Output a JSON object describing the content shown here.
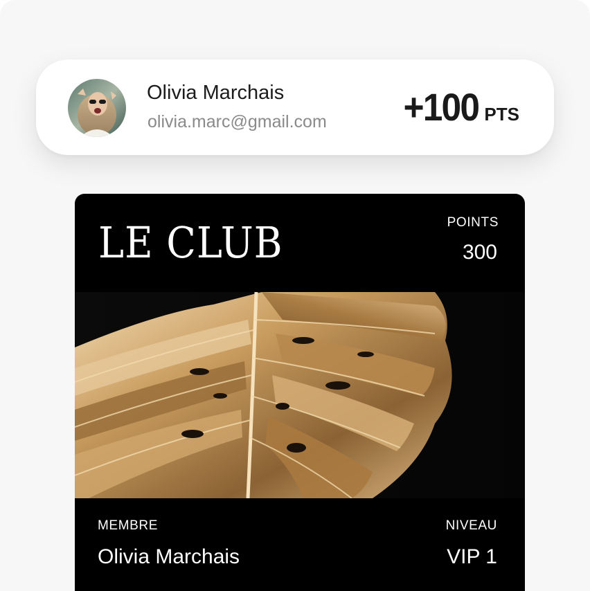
{
  "user": {
    "name": "Olivia Marchais",
    "email": "olivia.marc@gmail.com",
    "points_earned": "+100",
    "points_unit": "PTS"
  },
  "club_card": {
    "title": "LE CLUB",
    "points_label": "POINTS",
    "points_value": "300",
    "member_label": "MEMBRE",
    "member_value": "Olivia Marchais",
    "level_label": "NIVEAU",
    "level_value": "VIP 1"
  },
  "colors": {
    "background": "#f7f7f7",
    "card": "#000000",
    "gold": "#c9a46a",
    "text_dark": "#1c1c1c",
    "text_muted": "#8a8a8a"
  }
}
